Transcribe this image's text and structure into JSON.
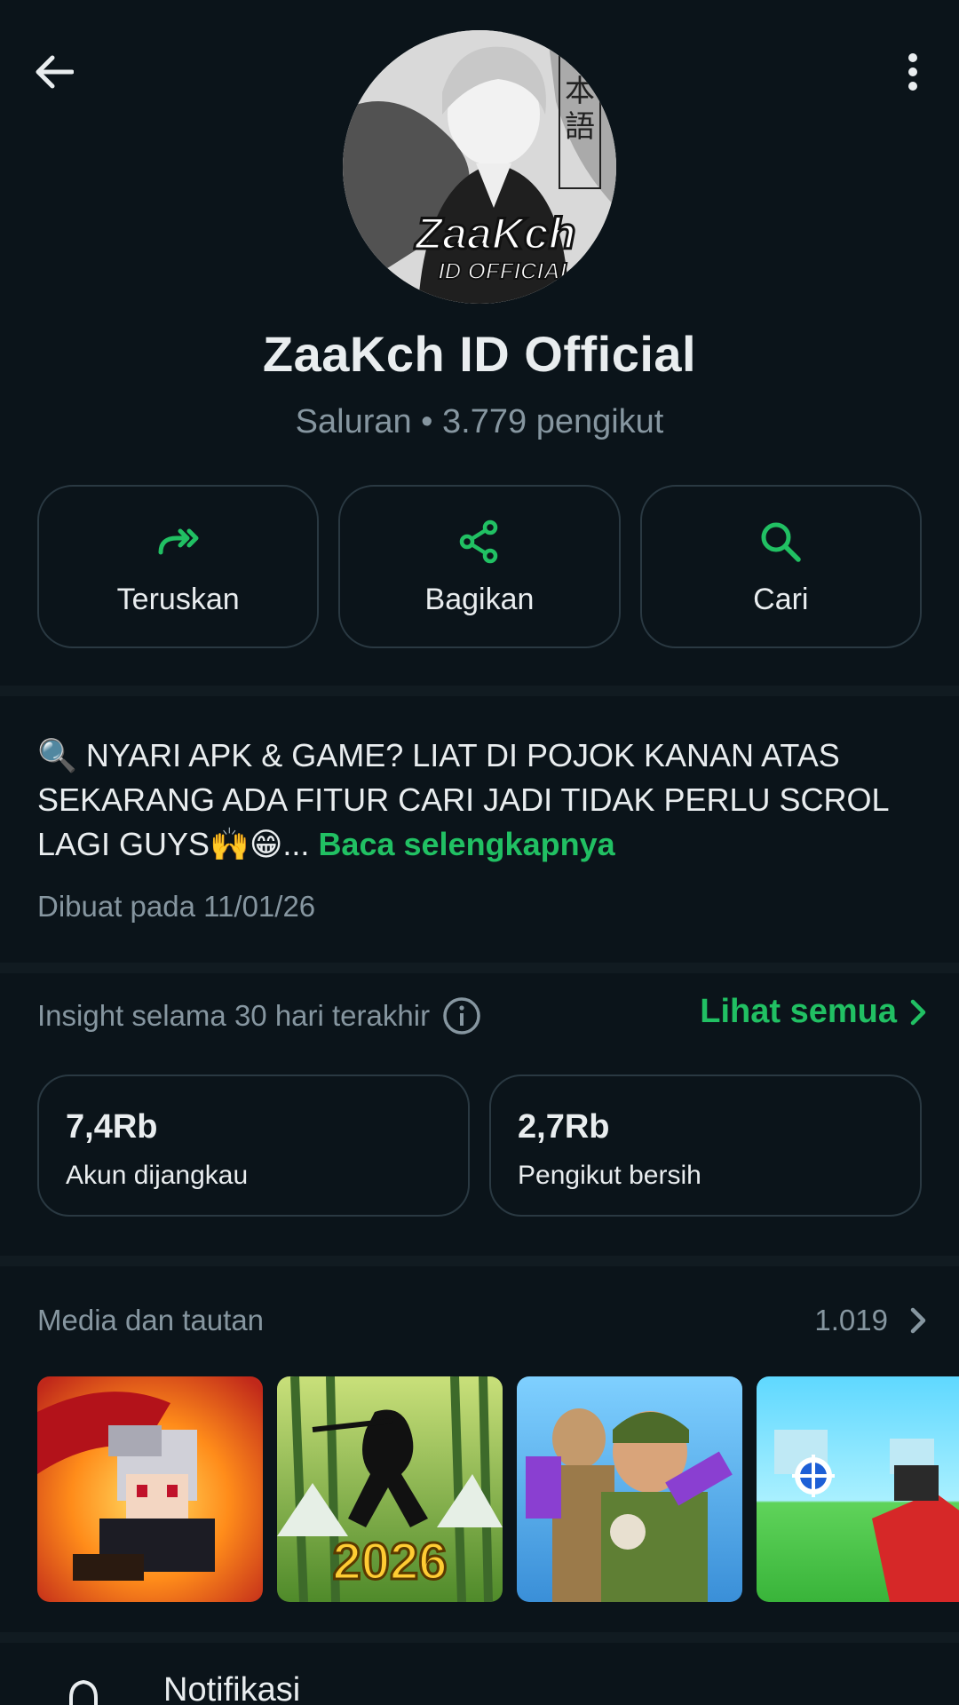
{
  "header": {
    "back_icon": "arrow-left-icon",
    "menu_icon": "more-vertical-icon"
  },
  "channel": {
    "avatar_text_main": "ZaaKch",
    "avatar_text_sub": "ID OFFICIAL",
    "avatar_kanji": "日本語",
    "name": "ZaaKch ID Official",
    "subtitle": "Saluran • 3.779 pengikut"
  },
  "actions": [
    {
      "label": "Teruskan",
      "icon": "forward-icon"
    },
    {
      "label": "Bagikan",
      "icon": "share-icon"
    },
    {
      "label": "Cari",
      "icon": "search-icon"
    }
  ],
  "description": {
    "text": "🔍 NYARI APK & GAME? LIAT DI POJOK KANAN ATAS SEKARANG ADA FITUR CARI JADI TIDAK PERLU SCROL LAGI GUYS🙌😁... ",
    "more_label": "Baca selengkapnya",
    "created": "Dibuat pada 11/01/26"
  },
  "insights": {
    "title": "Insight selama 30 hari terakhir",
    "see_all": "Lihat semua",
    "stats": [
      {
        "value": "7,4Rb",
        "label": "Akun dijangkau"
      },
      {
        "value": "2,7Rb",
        "label": "Pengikut bersih"
      }
    ]
  },
  "media": {
    "title": "Media dan tautan",
    "count": "1.019",
    "thumbs": [
      {
        "name": "pixel-ninja-game",
        "text": ""
      },
      {
        "name": "shadow-fight-game",
        "text": "2026"
      },
      {
        "name": "soldier-shooter-game",
        "text": ""
      },
      {
        "name": "fps-shooter-game",
        "text": ""
      }
    ]
  },
  "notification": {
    "label": "Notifikasi",
    "icon": "bell-icon"
  },
  "colors": {
    "background": "#0b141a",
    "accent": "#21c063",
    "muted": "#8696a0",
    "border": "#2a3942"
  }
}
